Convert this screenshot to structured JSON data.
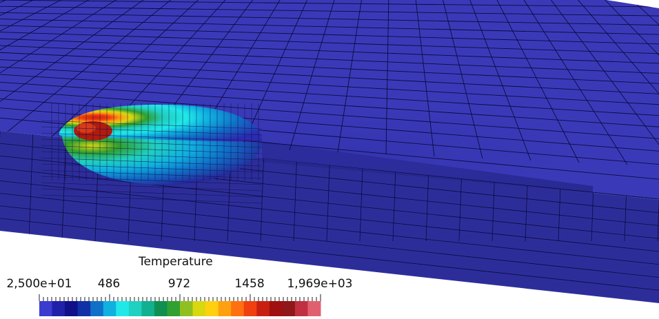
{
  "legend": {
    "title": "Temperature",
    "tick_labels": [
      "2,500e+01",
      "486",
      "972",
      "1458",
      "1,969e+03"
    ],
    "range": [
      25,
      1969
    ],
    "colormap": [
      "#3b3bd0",
      "#2020a8",
      "#101088",
      "#1030a8",
      "#1070c8",
      "#10b0e0",
      "#20e8e8",
      "#20d0c0",
      "#10b090",
      "#109050",
      "#30a030",
      "#90c020",
      "#d8d810",
      "#ffd010",
      "#ffa010",
      "#ff7010",
      "#f04010",
      "#c82010",
      "#a01010",
      "#901818",
      "#c03040",
      "#e06070"
    ]
  },
  "scene": {
    "background": "#ffffff",
    "plate_color": "#3a3ab8",
    "mesh_line_color": "#0a0a40"
  }
}
